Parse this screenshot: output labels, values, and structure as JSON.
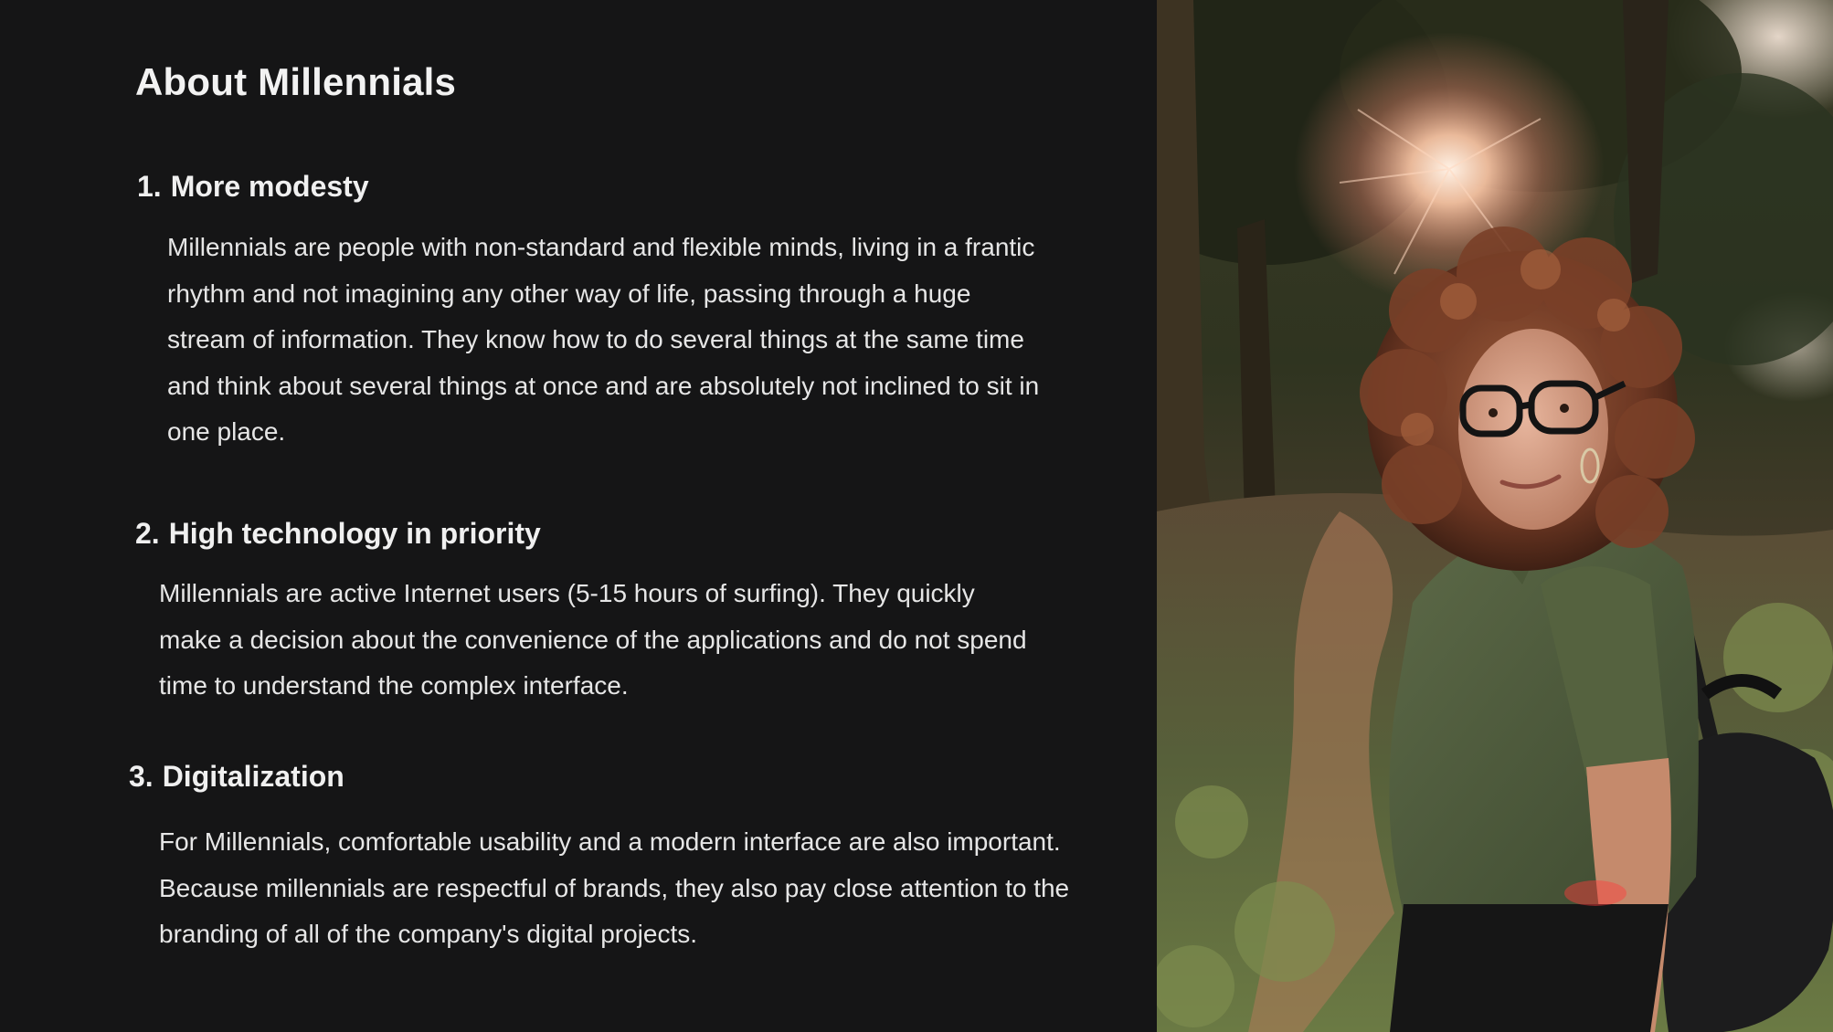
{
  "slide": {
    "title": "About Millennials",
    "sections": [
      {
        "number": "1.",
        "heading": "More modesty",
        "body": "Millennials are people with non-standard and flexible minds, living in a frantic rhythm and not imagining any other way of life, passing through a huge stream of information. They know how to do several things at the same time and think about several things at once and are absolutely not inclined to sit in one place."
      },
      {
        "number": "2.",
        "heading": "High technology in priority",
        "body": "Millennials are active Internet users (5-15 hours of surfing). They quickly make a decision about the convenience of the applications and do not spend time to understand the complex interface."
      },
      {
        "number": "3.",
        "heading": "Digitalization",
        "body": "For Millennials, comfortable usability and a modern interface are also important. Because millennials are respectful of brands, they also pay close attention to the branding of all of the company's digital projects."
      }
    ]
  },
  "colors": {
    "background": "#151516",
    "text": "#ededed"
  }
}
